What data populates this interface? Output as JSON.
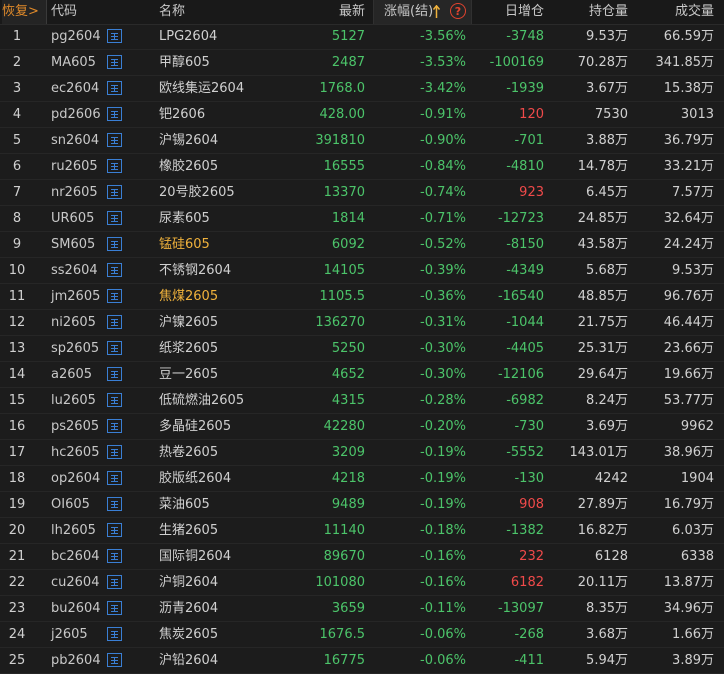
{
  "header": {
    "restore": "恢复>",
    "code": "代码",
    "name": "名称",
    "last": "最新",
    "change_pct": "涨幅(结)",
    "help": "?",
    "oi_change": "日增仓",
    "open_interest": "持仓量",
    "volume": "成交量"
  },
  "sort_icon": "sort-up-arrow-icon",
  "colors": {
    "down": "#4cc46a",
    "up": "#f04a4a",
    "highlight": "#f0b23c",
    "accent": "#e08a2a"
  },
  "rows": [
    {
      "idx": "1",
      "code": "pg2604",
      "name": "LPG2604",
      "hl": false,
      "last": "5127",
      "chg": "-3.56%",
      "oichg": "-3748",
      "oi": "9.53万",
      "vol": "66.59万"
    },
    {
      "idx": "2",
      "code": "MA605",
      "name": "甲醇605",
      "hl": false,
      "last": "2487",
      "chg": "-3.53%",
      "oichg": "-100169",
      "oi": "70.28万",
      "vol": "341.85万"
    },
    {
      "idx": "3",
      "code": "ec2604",
      "name": "欧线集运2604",
      "hl": false,
      "last": "1768.0",
      "chg": "-3.42%",
      "oichg": "-1939",
      "oi": "3.67万",
      "vol": "15.38万"
    },
    {
      "idx": "4",
      "code": "pd2606",
      "name": "钯2606",
      "hl": false,
      "last": "428.00",
      "chg": "-0.91%",
      "oichg": "120",
      "oi": "7530",
      "vol": "3013"
    },
    {
      "idx": "5",
      "code": "sn2604",
      "name": "沪锡2604",
      "hl": false,
      "last": "391810",
      "chg": "-0.90%",
      "oichg": "-701",
      "oi": "3.88万",
      "vol": "36.79万"
    },
    {
      "idx": "6",
      "code": "ru2605",
      "name": "橡胶2605",
      "hl": false,
      "last": "16555",
      "chg": "-0.84%",
      "oichg": "-4810",
      "oi": "14.78万",
      "vol": "33.21万"
    },
    {
      "idx": "7",
      "code": "nr2605",
      "name": "20号胶2605",
      "hl": false,
      "last": "13370",
      "chg": "-0.74%",
      "oichg": "923",
      "oi": "6.45万",
      "vol": "7.57万"
    },
    {
      "idx": "8",
      "code": "UR605",
      "name": "尿素605",
      "hl": false,
      "last": "1814",
      "chg": "-0.71%",
      "oichg": "-12723",
      "oi": "24.85万",
      "vol": "32.64万"
    },
    {
      "idx": "9",
      "code": "SM605",
      "name": "锰硅605",
      "hl": true,
      "last": "6092",
      "chg": "-0.52%",
      "oichg": "-8150",
      "oi": "43.58万",
      "vol": "24.24万"
    },
    {
      "idx": "10",
      "code": "ss2604",
      "name": "不锈钢2604",
      "hl": false,
      "last": "14105",
      "chg": "-0.39%",
      "oichg": "-4349",
      "oi": "5.68万",
      "vol": "9.53万"
    },
    {
      "idx": "11",
      "code": "jm2605",
      "name": "焦煤2605",
      "hl": true,
      "last": "1105.5",
      "chg": "-0.36%",
      "oichg": "-16540",
      "oi": "48.85万",
      "vol": "96.76万"
    },
    {
      "idx": "12",
      "code": "ni2605",
      "name": "沪镍2605",
      "hl": false,
      "last": "136270",
      "chg": "-0.31%",
      "oichg": "-1044",
      "oi": "21.75万",
      "vol": "46.44万"
    },
    {
      "idx": "13",
      "code": "sp2605",
      "name": "纸浆2605",
      "hl": false,
      "last": "5250",
      "chg": "-0.30%",
      "oichg": "-4405",
      "oi": "25.31万",
      "vol": "23.66万"
    },
    {
      "idx": "14",
      "code": "a2605",
      "name": "豆一2605",
      "hl": false,
      "last": "4652",
      "chg": "-0.30%",
      "oichg": "-12106",
      "oi": "29.64万",
      "vol": "19.66万"
    },
    {
      "idx": "15",
      "code": "lu2605",
      "name": "低硫燃油2605",
      "hl": false,
      "last": "4315",
      "chg": "-0.28%",
      "oichg": "-6982",
      "oi": "8.24万",
      "vol": "53.77万"
    },
    {
      "idx": "16",
      "code": "ps2605",
      "name": "多晶硅2605",
      "hl": false,
      "last": "42280",
      "chg": "-0.20%",
      "oichg": "-730",
      "oi": "3.69万",
      "vol": "9962"
    },
    {
      "idx": "17",
      "code": "hc2605",
      "name": "热卷2605",
      "hl": false,
      "last": "3209",
      "chg": "-0.19%",
      "oichg": "-5552",
      "oi": "143.01万",
      "vol": "38.96万"
    },
    {
      "idx": "18",
      "code": "op2604",
      "name": "胶版纸2604",
      "hl": false,
      "last": "4218",
      "chg": "-0.19%",
      "oichg": "-130",
      "oi": "4242",
      "vol": "1904"
    },
    {
      "idx": "19",
      "code": "OI605",
      "name": "菜油605",
      "hl": false,
      "last": "9489",
      "chg": "-0.19%",
      "oichg": "908",
      "oi": "27.89万",
      "vol": "16.79万"
    },
    {
      "idx": "20",
      "code": "lh2605",
      "name": "生猪2605",
      "hl": false,
      "last": "11140",
      "chg": "-0.18%",
      "oichg": "-1382",
      "oi": "16.82万",
      "vol": "6.03万"
    },
    {
      "idx": "21",
      "code": "bc2604",
      "name": "国际铜2604",
      "hl": false,
      "last": "89670",
      "chg": "-0.16%",
      "oichg": "232",
      "oi": "6128",
      "vol": "6338"
    },
    {
      "idx": "22",
      "code": "cu2604",
      "name": "沪铜2604",
      "hl": false,
      "last": "101080",
      "chg": "-0.16%",
      "oichg": "6182",
      "oi": "20.11万",
      "vol": "13.87万"
    },
    {
      "idx": "23",
      "code": "bu2604",
      "name": "沥青2604",
      "hl": false,
      "last": "3659",
      "chg": "-0.11%",
      "oichg": "-13097",
      "oi": "8.35万",
      "vol": "34.96万"
    },
    {
      "idx": "24",
      "code": "j2605",
      "name": "焦炭2605",
      "hl": false,
      "last": "1676.5",
      "chg": "-0.06%",
      "oichg": "-268",
      "oi": "3.68万",
      "vol": "1.66万"
    },
    {
      "idx": "25",
      "code": "pb2604",
      "name": "沪铅2604",
      "hl": false,
      "last": "16775",
      "chg": "-0.06%",
      "oichg": "-411",
      "oi": "5.94万",
      "vol": "3.89万"
    }
  ]
}
